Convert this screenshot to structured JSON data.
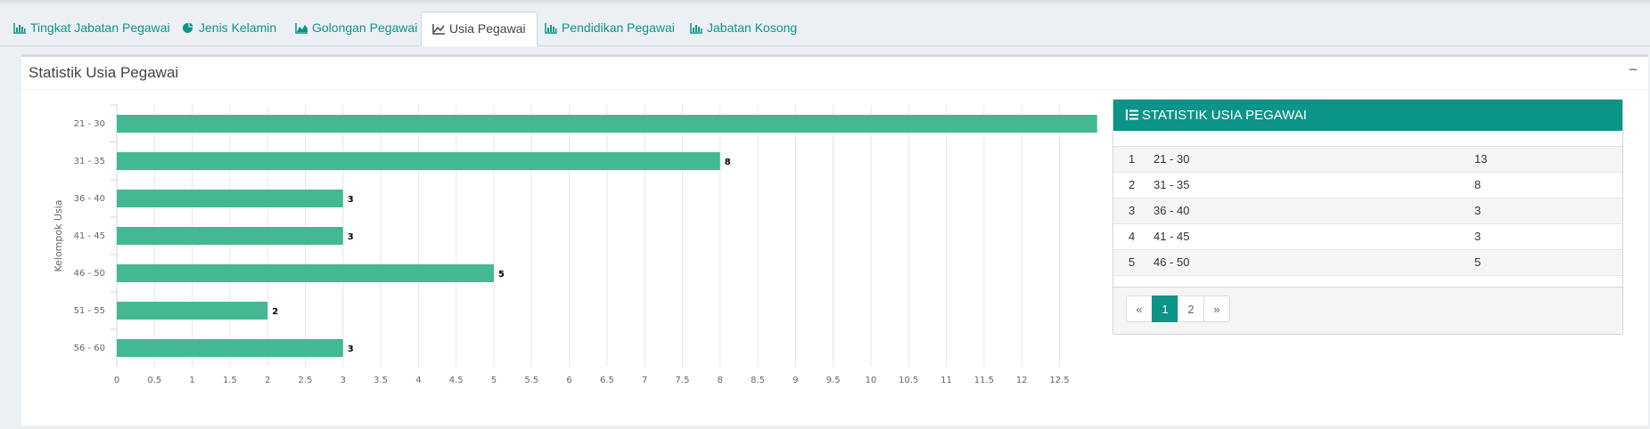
{
  "tabs": [
    {
      "label": "Tingkat Jabatan Pegawai",
      "icon": "bar-chart-icon",
      "active": false
    },
    {
      "label": "Jenis Kelamin",
      "icon": "pie-chart-icon",
      "active": false
    },
    {
      "label": "Golongan Pegawai",
      "icon": "area-chart-icon",
      "active": false
    },
    {
      "label": "Usia Pegawai",
      "icon": "line-chart-icon",
      "active": true
    },
    {
      "label": "Pendidikan Pegawai",
      "icon": "bar-chart-icon",
      "active": false
    },
    {
      "label": "Jabatan Kosong",
      "icon": "bar-chart-icon",
      "active": false
    }
  ],
  "box": {
    "title": "Statistik Usia Pegawai",
    "collapse_label": "−"
  },
  "colors": {
    "accent": "#0d9488",
    "bar": "#43b993",
    "grid": "#e6e6e6",
    "axis": "#ccd6eb"
  },
  "chart_data": {
    "type": "bar",
    "orientation": "horizontal",
    "categories": [
      "21 - 30",
      "31 - 35",
      "36 - 40",
      "41 - 45",
      "46 - 50",
      "51 - 55",
      "56 - 60"
    ],
    "values": [
      13,
      8,
      3,
      3,
      5,
      2,
      3
    ],
    "data_labels": [
      "",
      "8",
      "3",
      "3",
      "5",
      "2",
      "3"
    ],
    "ylabel": "Kelompok Usia",
    "xlim": [
      0,
      12.8
    ],
    "xticks": [
      "0",
      "0.5",
      "1",
      "1.5",
      "2",
      "2.5",
      "3",
      "3.5",
      "4",
      "4.5",
      "5",
      "5.5",
      "6",
      "6.5",
      "7",
      "7.5",
      "8",
      "8.5",
      "9",
      "9.5",
      "10",
      "10.5",
      "11",
      "11.5",
      "12",
      "12.5"
    ],
    "grid": true,
    "legend": "none"
  },
  "stats_panel": {
    "title": "STATISTIK USIA PEGAWAI",
    "icon": "list-ol-icon",
    "rows": [
      {
        "no": "1",
        "group": "21 - 30",
        "count": "13"
      },
      {
        "no": "2",
        "group": "31 - 35",
        "count": "8"
      },
      {
        "no": "3",
        "group": "36 - 40",
        "count": "3"
      },
      {
        "no": "4",
        "group": "41 - 45",
        "count": "3"
      },
      {
        "no": "5",
        "group": "46 - 50",
        "count": "5"
      }
    ],
    "pagination": {
      "prev": "«",
      "pages": [
        "1",
        "2"
      ],
      "active": "1",
      "next": "»"
    }
  }
}
